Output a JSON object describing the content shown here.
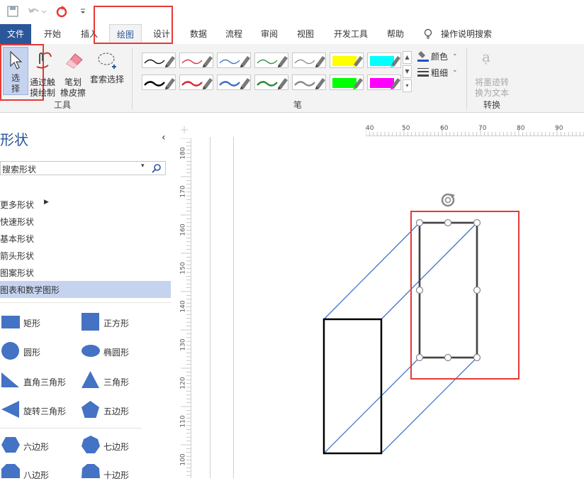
{
  "qat": {
    "icons": [
      "save-icon",
      "undo-icon",
      "redo-icon",
      "customize-icon"
    ]
  },
  "tabs": [
    {
      "label": "文件"
    },
    {
      "label": "开始"
    },
    {
      "label": "插入"
    },
    {
      "label": "绘图"
    },
    {
      "label": "设计"
    },
    {
      "label": "数据"
    },
    {
      "label": "流程"
    },
    {
      "label": "审阅"
    },
    {
      "label": "视图"
    },
    {
      "label": "开发工具"
    },
    {
      "label": "帮助"
    }
  ],
  "tell_me": "操作说明搜索",
  "ribbon": {
    "tools": {
      "select_line1": "选",
      "select_line2": "择",
      "touch_line1": "通过触",
      "touch_line2": "摸绘制",
      "eraser_line1": "笔划",
      "eraser_line2": "橡皮擦",
      "lasso": "套索选择",
      "group_label": "工具"
    },
    "pens": {
      "group_label": "笔",
      "colors_row1": [
        "#000000",
        "#d9283a",
        "#3f6fc4",
        "#2f8a3f",
        "#8a8a8a",
        "#ffff00",
        "#00ffff"
      ],
      "colors_row2": [
        "#000000",
        "#d9283a",
        "#3f6fc4",
        "#2f8a3f",
        "#8a8a8a",
        "#00ff00",
        "#ff00ff"
      ],
      "color_label": "颜色",
      "weight_label": "粗细"
    },
    "convert": {
      "line1": "将墨迹转",
      "line2": "换为文本",
      "group_label": "转换"
    }
  },
  "pane": {
    "title": "形状",
    "search_placeholder": "搜索形状",
    "nav": [
      "更多形状",
      "快速形状",
      "基本形状",
      "箭头形状",
      "图案形状",
      "图表和数学图形"
    ],
    "shapes": [
      {
        "label": "矩形"
      },
      {
        "label": "正方形"
      },
      {
        "label": "圆形"
      },
      {
        "label": "椭圆形"
      },
      {
        "label": "直角三角形"
      },
      {
        "label": "三角形"
      },
      {
        "label": "旋转三角形"
      },
      {
        "label": "五边形"
      },
      {
        "label": "六边形"
      },
      {
        "label": "七边形"
      },
      {
        "label": "八边形"
      },
      {
        "label": "十边形"
      }
    ]
  },
  "rulers": {
    "horizontal": [
      "40",
      "50",
      "60",
      "70",
      "80",
      "90"
    ],
    "vertical": [
      "180",
      "170",
      "160",
      "150",
      "140",
      "130",
      "120",
      "110",
      "100"
    ]
  },
  "colors": {
    "accent": "#2a579a",
    "shape_blue": "#4472c4",
    "highlight": "#e53935",
    "pane_selected": "#c5d3ef"
  }
}
